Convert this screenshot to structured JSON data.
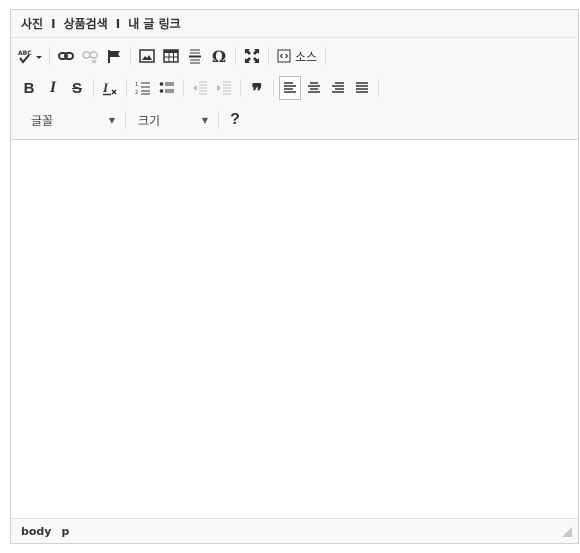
{
  "topbar": {
    "photo": "사진",
    "product_search": "상품검색",
    "my_link": "내 글 링크",
    "separator": "I"
  },
  "toolbar": {
    "source_label": "소스",
    "font_combo": "글꼴",
    "size_combo": "크기",
    "help_label": "?"
  },
  "statusbar": {
    "path": [
      "body",
      "p"
    ]
  },
  "colors": {
    "border": "#d1d1d1",
    "toolbar_bg": "#f8f8f8"
  }
}
